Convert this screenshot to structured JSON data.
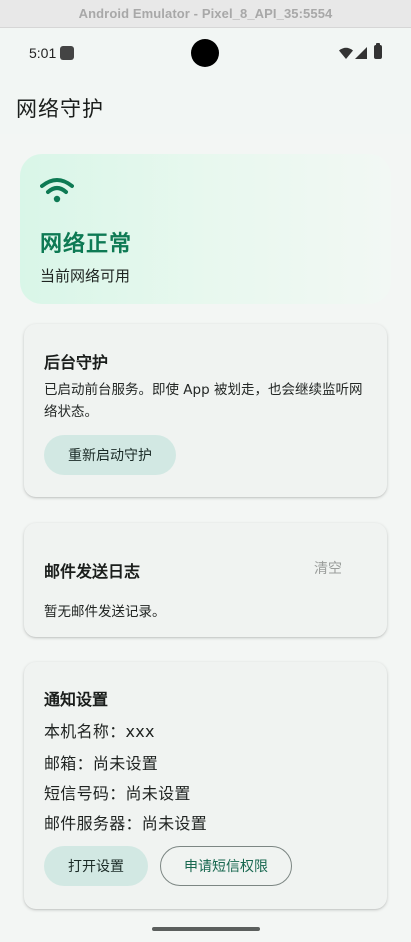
{
  "emulator": {
    "title": "Android Emulator - Pixel_8_API_35:5554"
  },
  "status_bar": {
    "time": "5:01"
  },
  "app": {
    "title": "网络守护"
  },
  "network_status": {
    "title": "网络正常",
    "subtitle": "当前网络可用",
    "accent_color": "#0e7a54"
  },
  "guard_card": {
    "title": "后台守护",
    "description": "已启动前台服务。即使 App 被划走，也会继续监听网络状态。",
    "button_label": "重新启动守护"
  },
  "mail_log_card": {
    "title": "邮件发送日志",
    "clear_label": "清空",
    "empty_text": "暂无邮件发送记录。"
  },
  "notify_card": {
    "title": "通知设置",
    "device_name": "本机名称：xxx",
    "email": "邮箱：尚未设置",
    "sms_number": "短信号码：尚未设置",
    "mail_server": "邮件服务器：尚未设置",
    "open_settings_label": "打开设置",
    "request_sms_label": "申请短信权限"
  }
}
